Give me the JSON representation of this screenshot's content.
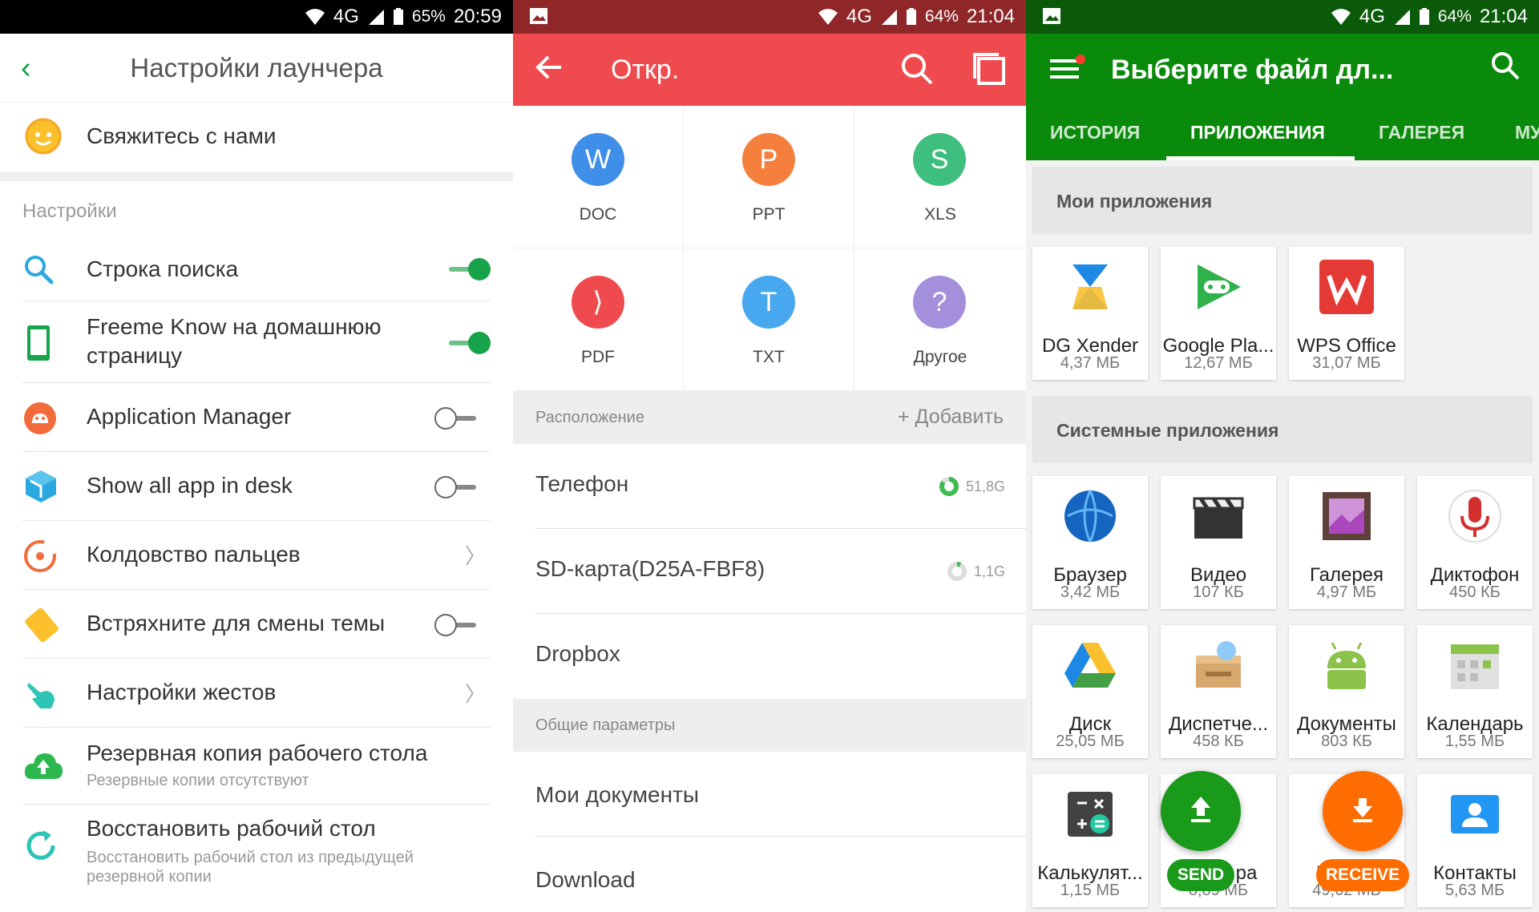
{
  "launcher": {
    "status": {
      "battery": "65%",
      "time": "20:59",
      "network": "4G"
    },
    "title": "Настройки лаунчера",
    "contact": "Свяжитесь с нами",
    "section": "Настройки",
    "rows": [
      {
        "label": "Строка поиска",
        "state": "on"
      },
      {
        "label": "Freeme Know на домашнюю",
        "label2": "страницу",
        "state": "on"
      },
      {
        "label": "Application Manager",
        "state": "off"
      },
      {
        "label": "Show all app in desk",
        "state": "off"
      },
      {
        "label": "Колдовство пальцев",
        "state": "chevron"
      },
      {
        "label": "Встряхните для смены темы",
        "state": "off"
      },
      {
        "label": "Настройки жестов",
        "state": "chevron"
      },
      {
        "label": "Резервная копия рабочего стола",
        "sub": "Резервные копии отсутствуют"
      },
      {
        "label": "Восстановить рабочий стол",
        "sub": "Восстановить рабочий стол из предыдущей",
        "sub2": "резервной копии"
      }
    ],
    "chevron": "〉",
    "back_glyph": "‹"
  },
  "opener": {
    "status": {
      "battery": "64%",
      "time": "21:04",
      "network": "4G"
    },
    "title": "Откр.",
    "types": [
      {
        "label": "DOC",
        "glyph": "W",
        "color": "#3f8fe8"
      },
      {
        "label": "PPT",
        "glyph": "P",
        "color": "#f5803e"
      },
      {
        "label": "XLS",
        "glyph": "S",
        "color": "#3fbf7f"
      },
      {
        "label": "PDF",
        "glyph": "⟩",
        "color": "#ef4b4f"
      },
      {
        "label": "TXT",
        "glyph": "T",
        "color": "#47a8f0"
      },
      {
        "label": "Другое",
        "glyph": "?",
        "color": "#a48fdc"
      }
    ],
    "location_header": "Расположение",
    "add_label": "+ Добавить",
    "locations": [
      {
        "label": "Телефон",
        "size": "51,8G"
      },
      {
        "label": "SD-карта(D25A-FBF8)",
        "size": "1,1G"
      },
      {
        "label": "Dropbox"
      }
    ],
    "general_header": "Общие параметры",
    "general": [
      "Мои документы",
      "Download"
    ]
  },
  "picker": {
    "status": {
      "battery": "64%",
      "time": "21:04",
      "network": "4G"
    },
    "title": "Выберите файл дл...",
    "tabs": [
      "ИСТОРИЯ",
      "ПРИЛОЖЕНИЯ",
      "ГАЛЕРЕЯ",
      "МУ"
    ],
    "my_apps_header": "Мои приложения",
    "my_apps": [
      {
        "name": "DG Xender",
        "size": "4,37 МБ"
      },
      {
        "name": "Google Pla...",
        "size": "12,67 МБ"
      },
      {
        "name": "WPS Office",
        "size": "31,07 МБ"
      }
    ],
    "system_header": "Системные приложения",
    "system_apps": [
      {
        "name": "Браузер",
        "size": "3,42 МБ"
      },
      {
        "name": "Видео",
        "size": "107 КБ"
      },
      {
        "name": "Галерея",
        "size": "4,97 МБ"
      },
      {
        "name": "Диктофон",
        "size": "450 КБ"
      },
      {
        "name": "Диск",
        "size": "25,05 МБ"
      },
      {
        "name": "Диспетче...",
        "size": "458 КБ"
      },
      {
        "name": "Документы",
        "size": "803 КБ"
      },
      {
        "name": "Календарь",
        "size": "1,55 МБ"
      },
      {
        "name": "Калькулят...",
        "size": "1,15 МБ"
      },
      {
        "name": "ра",
        "size": "8,89 МБ"
      },
      {
        "name": "I",
        "size": "49,62 МБ"
      },
      {
        "name": "Контакты",
        "size": "5,63 МБ"
      }
    ],
    "send_label": "SEND",
    "receive_label": "RECEIVE",
    "colors": {
      "green": "#0a8a0a",
      "orange": "#ff6d00",
      "send_green": "#1a9a1a"
    }
  }
}
